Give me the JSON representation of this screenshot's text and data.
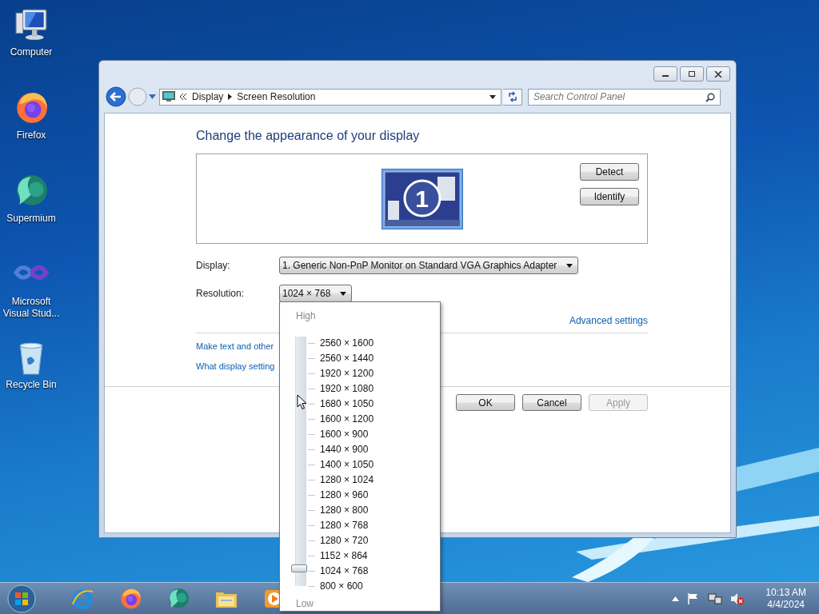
{
  "desktop_icons": [
    {
      "label": "Computer",
      "kind": "computer"
    },
    {
      "label": "Firefox",
      "kind": "firefox"
    },
    {
      "label": "Supermium",
      "kind": "supermium"
    },
    {
      "label": "Microsoft Visual Stud...",
      "kind": "visualstudio"
    },
    {
      "label": "Recycle Bin",
      "kind": "recycle"
    }
  ],
  "window": {
    "breadcrumb": [
      "Display",
      "Screen Resolution"
    ],
    "search": {
      "placeholder": "Search Control Panel"
    },
    "heading": "Change the appearance of your display",
    "monitor_number": "1",
    "preview_buttons": [
      {
        "label": "Detect"
      },
      {
        "label": "Identify"
      }
    ],
    "fields": [
      {
        "label": "Display:",
        "value": "1. Generic Non-PnP Monitor on Standard VGA Graphics Adapter"
      },
      {
        "label": "Resolution:",
        "value": "1024 × 768"
      }
    ],
    "advanced_link": "Advanced settings",
    "links": [
      "Make text and other",
      "What display setting"
    ],
    "footer_buttons": [
      {
        "label": "OK",
        "disabled": false
      },
      {
        "label": "Cancel",
        "disabled": false
      },
      {
        "label": "Apply",
        "disabled": true
      }
    ]
  },
  "resolution_menu": {
    "high_label": "High",
    "low_label": "Low",
    "level": 0.0625,
    "options": [
      "2560 × 1600",
      "2560 × 1440",
      "1920 × 1200",
      "1920 × 1080",
      "1680 × 1050",
      "1600 × 1200",
      "1600 × 900",
      "1440 × 900",
      "1400 × 1050",
      "1280 × 1024",
      "1280 × 960",
      "1280 × 800",
      "1280 × 768",
      "1280 × 720",
      "1152 × 864",
      "1024 × 768",
      "800 × 600"
    ]
  },
  "taskbar": {
    "apps": [
      {
        "kind": "ie"
      },
      {
        "kind": "firefox"
      },
      {
        "kind": "supermium"
      },
      {
        "kind": "explorer"
      },
      {
        "kind": "media"
      }
    ],
    "tray": [
      {
        "kind": "arrow"
      },
      {
        "kind": "flag"
      },
      {
        "kind": "network"
      },
      {
        "kind": "speaker-muted"
      }
    ],
    "clock": {
      "time": "10:13 AM",
      "date": "4/4/2024"
    }
  }
}
